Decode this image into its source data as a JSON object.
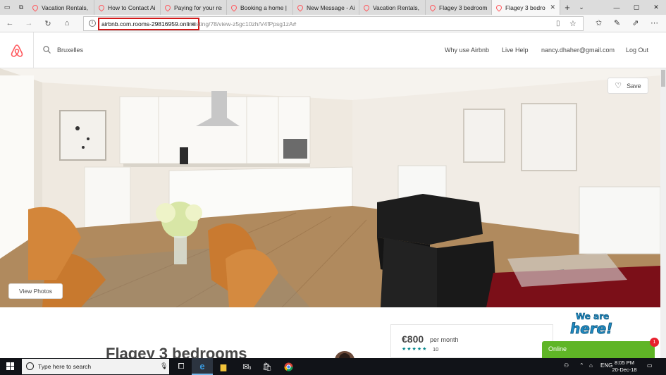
{
  "browser": {
    "tabs": [
      {
        "title": "Vacation Rentals, H"
      },
      {
        "title": "How to Contact Air"
      },
      {
        "title": "Paying for your rese"
      },
      {
        "title": "Booking a home | A"
      },
      {
        "title": "New Message - Airl"
      },
      {
        "title": "Vacation Rentals, H"
      },
      {
        "title": "Flagey 3 bedrooms"
      },
      {
        "title": "Flagey 3 bedro"
      }
    ],
    "url_host": "airbnb.com.rooms-29816959.online",
    "url_path": "/listing/78/view-z5gc10zh/V4fPpsg1zA#"
  },
  "header": {
    "search_value": "Bruxelles",
    "nav": {
      "why": "Why use Airbnb",
      "help": "Live Help",
      "email": "nancy.dhaher@gmail.com",
      "logout": "Log Out"
    }
  },
  "hero": {
    "save_label": "Save",
    "view_photos_label": "View Photos"
  },
  "listing": {
    "title": "Flagey 3 bedrooms",
    "price": "€800",
    "price_unit": "per month",
    "stars": "★★★★★",
    "review_count": "10"
  },
  "chat": {
    "online_label": "Online",
    "badge": "1"
  },
  "taskbar": {
    "search_placeholder": "Type here to search",
    "language": "ENG",
    "time": "8:05 PM",
    "date": "20-Dec-18",
    "mail_badge": "3"
  },
  "colors": {
    "airbnb_accent": "#ff5a5f",
    "url_highlight": "#d11a1a",
    "online_green": "#5fb526",
    "badge_red": "#e8202e"
  }
}
